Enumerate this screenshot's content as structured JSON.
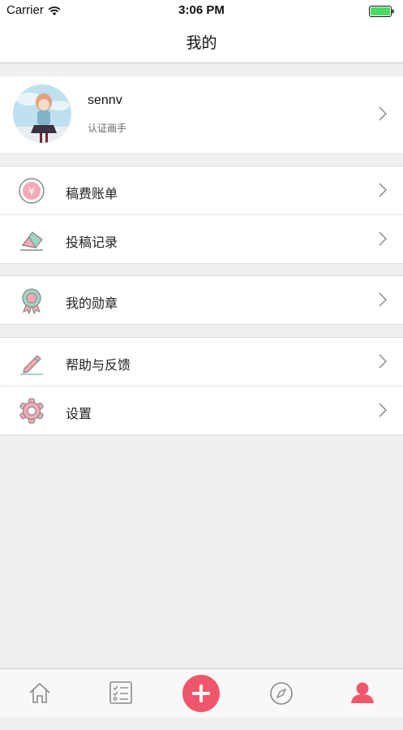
{
  "status_bar": {
    "carrier": "Carrier",
    "time": "3:06 PM",
    "battery_color": "#4cd964"
  },
  "nav": {
    "title": "我的"
  },
  "profile": {
    "name": "sennv",
    "tag": "认证画手"
  },
  "menu_groups": [
    {
      "items": [
        {
          "label": "稿费账单",
          "icon": "yen-coin-icon"
        },
        {
          "label": "投稿记录",
          "icon": "eraser-icon"
        }
      ]
    },
    {
      "items": [
        {
          "label": "我的勋章",
          "icon": "medal-icon"
        }
      ]
    },
    {
      "items": [
        {
          "label": "帮助与反馈",
          "icon": "pencil-icon"
        },
        {
          "label": "设置",
          "icon": "gear-icon"
        }
      ]
    }
  ],
  "tab_bar": {
    "tabs": [
      "home-icon",
      "task-list-icon",
      "add-icon",
      "compass-icon",
      "profile-icon"
    ],
    "accent_color": "#f0566b",
    "selected": "profile-icon"
  },
  "colors": {
    "icon_pink": "#f5a9b8",
    "icon_gray": "#8a8a8a",
    "icon_green": "#9fd6c7"
  }
}
